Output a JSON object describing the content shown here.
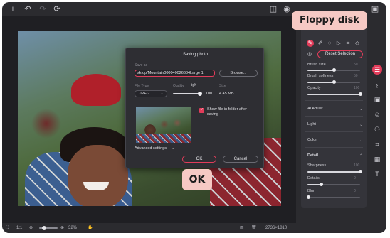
{
  "toolbar": {
    "icons": [
      "plus-icon",
      "undo-icon",
      "redo-icon",
      "reset-icon",
      "compare-icon",
      "preview-icon",
      "save-icon"
    ],
    "icon_glyphs": {
      "add": "+",
      "undo": "↶",
      "redo": "↷",
      "reset": "⟳",
      "compare": "◫",
      "preview": "◉",
      "save": "▣"
    }
  },
  "callouts": {
    "save": "Floppy disk",
    "ok": "OK"
  },
  "dialog": {
    "title": "Saving photo",
    "save_as_label": "Save as",
    "path": "sktop/Mountain000040026684Large 1",
    "browse": "Browse...",
    "file_type_label": "File Type",
    "file_type": "JPEG",
    "quality_label": "Quality",
    "quality_level": "High",
    "quality_value": "100",
    "size_label": "Size",
    "size_value": "4.45 MB",
    "show_in_folder": "Show file in folder after saving",
    "show_in_folder_checked": true,
    "advanced": "Advanced settings",
    "ok": "OK",
    "cancel": "Cancel"
  },
  "panel": {
    "reset_selection": "Reset Selection",
    "brush_size": {
      "label": "Brush size",
      "value": "50"
    },
    "brush_softness": {
      "label": "Brush softness",
      "value": "50"
    },
    "opacity": {
      "label": "Opacity",
      "value": "100"
    },
    "sections": [
      "AI Adjust",
      "Light",
      "Color"
    ],
    "detail": {
      "title": "Detail",
      "sharpness": {
        "label": "Sharpness",
        "value": "100"
      },
      "details": {
        "label": "Details",
        "value": "0"
      },
      "blur": {
        "label": "Blur",
        "value": "0"
      }
    }
  },
  "bottombar": {
    "ratio": "1:1",
    "zoom": "32%",
    "dimensions": "2736×1810"
  },
  "colors": {
    "accent": "#e23c5a",
    "app_bg": "#2b2b2f",
    "callout_bg": "#f6c9c4"
  }
}
